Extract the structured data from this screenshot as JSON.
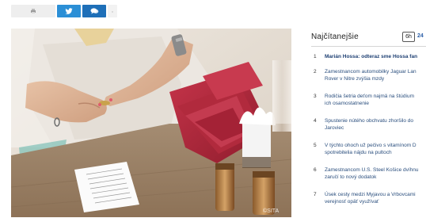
{
  "share": {
    "buttons": [
      {
        "icon": "print-icon",
        "color": "#eeeeee"
      },
      {
        "icon": "twitter-icon",
        "color": "#2b8fd6"
      },
      {
        "icon": "comment-icon",
        "color": "#1e6fb8"
      },
      {
        "icon": "more-icon",
        "color": "#f2f2f2"
      }
    ]
  },
  "photo": {
    "watermark": "©SITA"
  },
  "sidebar": {
    "title": "Najčítanejšie",
    "tab_active": "6h",
    "tab_next": "24",
    "items": [
      {
        "num": "1",
        "line1": "Marián Hossa: odteraz sme Hossa fan",
        "line2": ""
      },
      {
        "num": "2",
        "line1": "Zamestnancom automobilky Jaguar Lan",
        "line2": "Rover v Nitre zvýšia mzdy"
      },
      {
        "num": "3",
        "line1": "Rodičia šetria deťom najmä na štúdium",
        "line2": "ich osamostatnenie"
      },
      {
        "num": "4",
        "line1": "Spustenie nútého obchvatu zhoršilo do",
        "line2": "Jaroviec"
      },
      {
        "num": "5",
        "line1": "V týchto ohoch už pečivo s vitamínom D",
        "line2": "spotrebitelia nájdu na pultoch"
      },
      {
        "num": "6",
        "line1": "Zamestnancom U.S. Steel Košice dvíhnu",
        "line2": "zaručí to nový dodatok"
      },
      {
        "num": "7",
        "line1": "Úsek cesty medzi Myjavou a Vrbovcami",
        "line2": "verejnosť opäť využívať"
      }
    ]
  },
  "colors": {
    "twitter": "#2b8fd6",
    "comment": "#1e6fb8",
    "link": "#2b4f7e",
    "wallet": "#b3263a"
  }
}
